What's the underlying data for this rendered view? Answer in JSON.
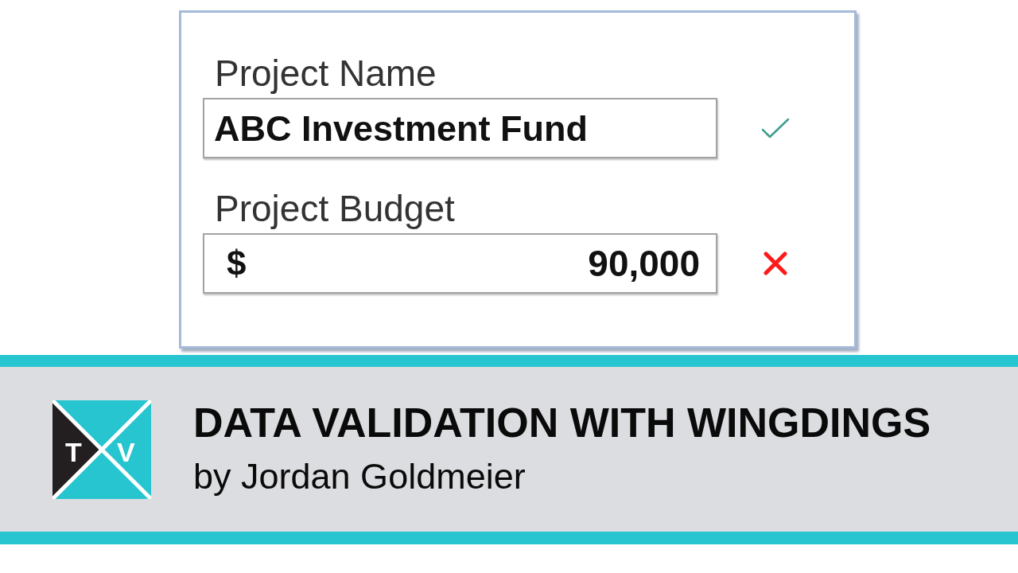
{
  "form": {
    "fields": [
      {
        "label": "Project Name",
        "kind": "text",
        "value": "ABC Investment Fund",
        "valid": true
      },
      {
        "label": "Project Budget",
        "kind": "currency",
        "prefix": "$",
        "value": "90,000",
        "valid": false
      }
    ]
  },
  "banner": {
    "logo": {
      "letters": [
        "T",
        "V"
      ]
    },
    "title": "DATA VALIDATION WITH WINGDINGS",
    "byline": "by Jordan Goldmeier"
  }
}
